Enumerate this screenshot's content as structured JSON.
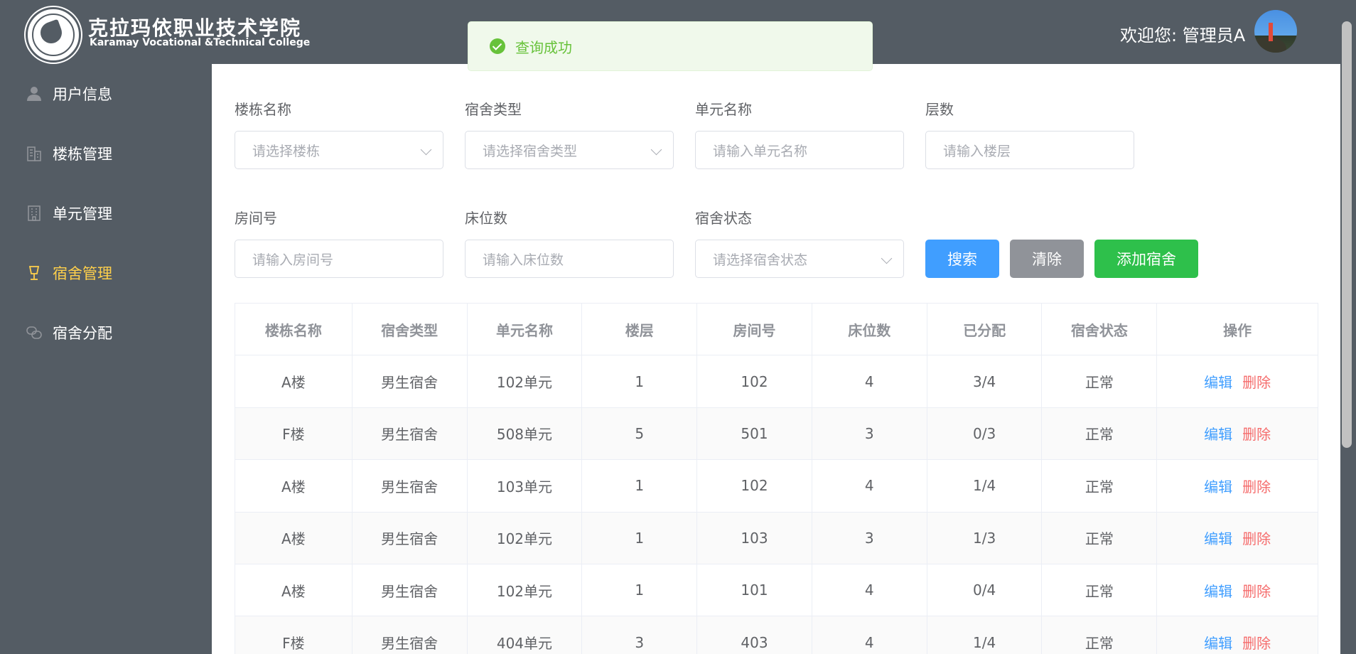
{
  "header": {
    "school_name_cn": "克拉玛依职业技术学院",
    "school_name_en": "Karamay Vocational &Technical College",
    "welcome": "欢迎您: 管理员A"
  },
  "toast": {
    "message": "查询成功"
  },
  "sidebar": {
    "items": [
      {
        "label": "用户信息",
        "icon": "user-icon",
        "active": false
      },
      {
        "label": "楼栋管理",
        "icon": "building-icon",
        "active": false
      },
      {
        "label": "单元管理",
        "icon": "office-icon",
        "active": false
      },
      {
        "label": "宿舍管理",
        "icon": "lamp-icon",
        "active": true
      },
      {
        "label": "宿舍分配",
        "icon": "link-icon",
        "active": false
      }
    ]
  },
  "filters": {
    "building": {
      "label": "楼栋名称",
      "placeholder": "请选择楼栋"
    },
    "dorm_type": {
      "label": "宿舍类型",
      "placeholder": "请选择宿舍类型"
    },
    "unit": {
      "label": "单元名称",
      "placeholder": "请输入单元名称"
    },
    "floor": {
      "label": "层数",
      "placeholder": "请输入楼层"
    },
    "room": {
      "label": "房间号",
      "placeholder": "请输入房间号"
    },
    "beds": {
      "label": "床位数",
      "placeholder": "请输入床位数"
    },
    "status": {
      "label": "宿舍状态",
      "placeholder": "请选择宿舍状态"
    }
  },
  "buttons": {
    "search": "搜索",
    "clear": "清除",
    "add": "添加宿舍"
  },
  "table": {
    "columns": [
      "楼栋名称",
      "宿舍类型",
      "单元名称",
      "楼层",
      "房间号",
      "床位数",
      "已分配",
      "宿舍状态",
      "操作"
    ],
    "rows": [
      [
        "A楼",
        "男生宿舍",
        "102单元",
        "1",
        "102",
        "4",
        "3/4",
        "正常"
      ],
      [
        "F楼",
        "男生宿舍",
        "508单元",
        "5",
        "501",
        "3",
        "0/3",
        "正常"
      ],
      [
        "A楼",
        "男生宿舍",
        "103单元",
        "1",
        "102",
        "4",
        "1/4",
        "正常"
      ],
      [
        "A楼",
        "男生宿舍",
        "102单元",
        "1",
        "103",
        "3",
        "1/3",
        "正常"
      ],
      [
        "A楼",
        "男生宿舍",
        "102单元",
        "1",
        "101",
        "4",
        "0/4",
        "正常"
      ],
      [
        "F楼",
        "男生宿舍",
        "404单元",
        "3",
        "403",
        "4",
        "1/4",
        "正常"
      ]
    ],
    "edit_label": "编辑",
    "delete_label": "删除"
  },
  "colors": {
    "sidebar_bg": "#545c64",
    "active": "#ffd04b",
    "primary": "#409eff",
    "success": "#2ec04b",
    "danger": "#f56c6c"
  }
}
